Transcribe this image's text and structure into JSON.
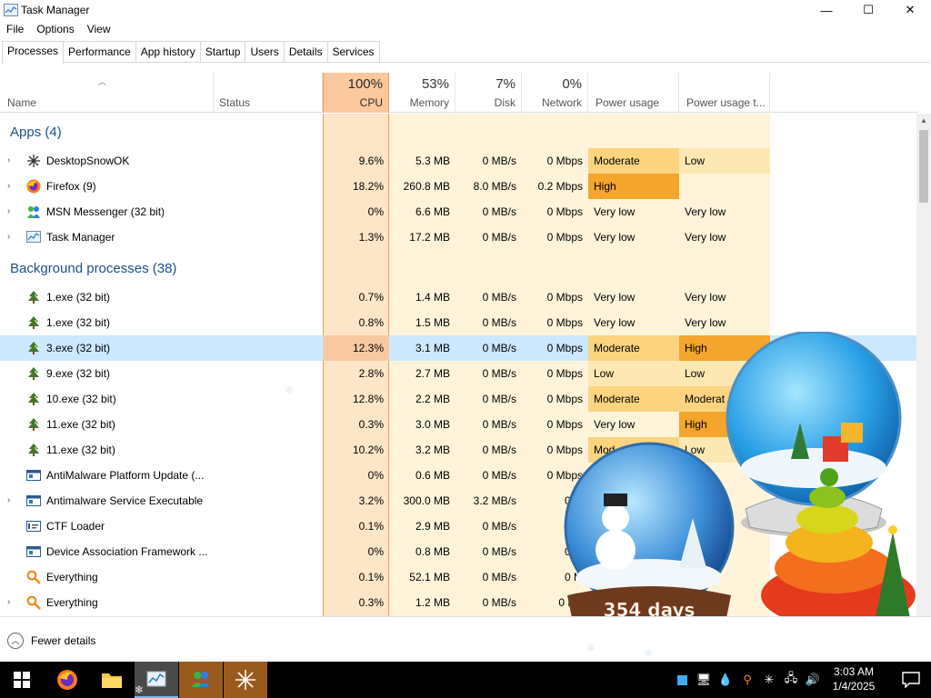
{
  "window": {
    "title": "Task Manager",
    "minimize": "—",
    "maximize": "☐",
    "close": "✕"
  },
  "menu": [
    "File",
    "Options",
    "View"
  ],
  "tabs": [
    "Processes",
    "Performance",
    "App history",
    "Startup",
    "Users",
    "Details",
    "Services"
  ],
  "active_tab": "Processes",
  "columns": {
    "name": "Name",
    "status": "Status",
    "cpu": {
      "pct": "100%",
      "label": "CPU"
    },
    "memory": {
      "pct": "53%",
      "label": "Memory"
    },
    "disk": {
      "pct": "7%",
      "label": "Disk"
    },
    "network": {
      "pct": "0%",
      "label": "Network"
    },
    "power": "Power usage",
    "power_trend": "Power usage t..."
  },
  "groups": {
    "apps": "Apps (4)",
    "background": "Background processes (38)"
  },
  "apps": [
    {
      "name": "DesktopSnowOK",
      "cpu": "9.6%",
      "mem": "5.3 MB",
      "disk": "0 MB/s",
      "net": "0 Mbps",
      "power": "Moderate",
      "trend": "Low",
      "expand": true,
      "icon": "snowflake-icon"
    },
    {
      "name": "Firefox (9)",
      "cpu": "18.2%",
      "mem": "260.8 MB",
      "disk": "8.0 MB/s",
      "net": "0.2 Mbps",
      "power": "High",
      "trend": "",
      "expand": true,
      "icon": "firefox-icon"
    },
    {
      "name": "MSN Messenger (32 bit)",
      "cpu": "0%",
      "mem": "6.6 MB",
      "disk": "0 MB/s",
      "net": "0 Mbps",
      "power": "Very low",
      "trend": "Very low",
      "expand": true,
      "icon": "msn-icon"
    },
    {
      "name": "Task Manager",
      "cpu": "1.3%",
      "mem": "17.2 MB",
      "disk": "0 MB/s",
      "net": "0 Mbps",
      "power": "Very low",
      "trend": "Very low",
      "expand": true,
      "icon": "taskmanager-icon"
    }
  ],
  "background": [
    {
      "name": "1.exe (32 bit)",
      "cpu": "0.7%",
      "mem": "1.4 MB",
      "disk": "0 MB/s",
      "net": "0 Mbps",
      "power": "Very low",
      "trend": "Very low",
      "expand": false,
      "icon": "tree-icon"
    },
    {
      "name": "1.exe (32 bit)",
      "cpu": "0.8%",
      "mem": "1.5 MB",
      "disk": "0 MB/s",
      "net": "0 Mbps",
      "power": "Very low",
      "trend": "Very low",
      "expand": false,
      "icon": "tree-icon"
    },
    {
      "name": "3.exe (32 bit)",
      "cpu": "12.3%",
      "mem": "3.1 MB",
      "disk": "0 MB/s",
      "net": "0 Mbps",
      "power": "Moderate",
      "trend": "High",
      "expand": false,
      "icon": "tree-icon",
      "selected": true
    },
    {
      "name": "9.exe (32 bit)",
      "cpu": "2.8%",
      "mem": "2.7 MB",
      "disk": "0 MB/s",
      "net": "0 Mbps",
      "power": "Low",
      "trend": "Low",
      "expand": false,
      "icon": "tree-icon"
    },
    {
      "name": "10.exe (32 bit)",
      "cpu": "12.8%",
      "mem": "2.2 MB",
      "disk": "0 MB/s",
      "net": "0 Mbps",
      "power": "Moderate",
      "trend": "Moderat",
      "expand": false,
      "icon": "tree-icon"
    },
    {
      "name": "11.exe (32 bit)",
      "cpu": "0.3%",
      "mem": "3.0 MB",
      "disk": "0 MB/s",
      "net": "0 Mbps",
      "power": "Very low",
      "trend": "High",
      "expand": false,
      "icon": "tree-icon"
    },
    {
      "name": "11.exe (32 bit)",
      "cpu": "10.2%",
      "mem": "3.2 MB",
      "disk": "0 MB/s",
      "net": "0 Mbps",
      "power": "Mod",
      "trend": "Low",
      "expand": false,
      "icon": "tree-icon"
    },
    {
      "name": "AntiMalware Platform Update (...",
      "cpu": "0%",
      "mem": "0.6 MB",
      "disk": "0 MB/s",
      "net": "0 Mbps",
      "power": "",
      "trend": "",
      "expand": false,
      "icon": "window-icon"
    },
    {
      "name": "Antimalware Service Executable",
      "cpu": "3.2%",
      "mem": "300.0 MB",
      "disk": "3.2 MB/s",
      "net": "0 M",
      "power": "",
      "trend": "",
      "expand": true,
      "icon": "window-icon"
    },
    {
      "name": "CTF Loader",
      "cpu": "0.1%",
      "mem": "2.9 MB",
      "disk": "0 MB/s",
      "net": "0 M",
      "power": "",
      "trend": "",
      "expand": false,
      "icon": "ctf-icon"
    },
    {
      "name": "Device Association Framework ...",
      "cpu": "0%",
      "mem": "0.8 MB",
      "disk": "0 MB/s",
      "net": "0 M",
      "power": "",
      "trend": "",
      "expand": false,
      "icon": "window-icon"
    },
    {
      "name": "Everything",
      "cpu": "0.1%",
      "mem": "52.1 MB",
      "disk": "0 MB/s",
      "net": "0 M",
      "power": "",
      "trend": "",
      "expand": false,
      "icon": "everything-icon"
    },
    {
      "name": "Everything",
      "cpu": "0.3%",
      "mem": "1.2 MB",
      "disk": "0 MB/s",
      "net": "0 Mb",
      "power": "",
      "trend": "",
      "expand": true,
      "icon": "everything-icon"
    }
  ],
  "footer": {
    "fewer_details": "Fewer details"
  },
  "taskbar": {
    "items": [
      "start",
      "firefox",
      "file-explorer",
      "task-manager",
      "msn",
      "desktopsnowok"
    ],
    "time": "3:03 AM",
    "date": "1/4/2025"
  },
  "decoration": {
    "globe_text": "354 days",
    "globe_text_partial": "354"
  },
  "colors": {
    "cpu_header": "#fcc89d",
    "cpu_col": "#fde6c7",
    "col_light": "#fff4d9",
    "high": "#f4a52b",
    "moderate": "#fcd47f",
    "low": "#fde8b3",
    "selected": "#cce8ff",
    "group_title": "#1e4f8c"
  }
}
